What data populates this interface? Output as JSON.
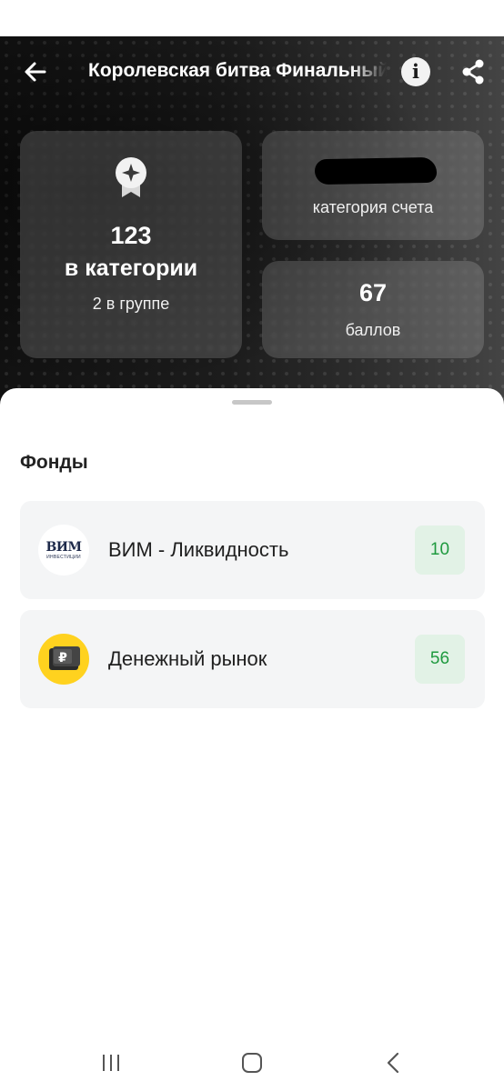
{
  "header": {
    "title": "Королевская битва Финальный",
    "back_icon": "arrow-left-icon",
    "info_label": "i",
    "share_icon": "share-icon"
  },
  "stats": {
    "rank": {
      "icon": "medal-star-icon",
      "value": "123",
      "label": "в категории",
      "sub": "2 в группе"
    },
    "account": {
      "value_redacted": true,
      "label": "категория счета"
    },
    "points": {
      "value": "67",
      "label": "баллов"
    }
  },
  "funds": {
    "title": "Фонды",
    "items": [
      {
        "logo_text": "ВИМ",
        "logo_sub": "ИНВЕСТИЦИИ",
        "name": "ВИМ - Ликвидность",
        "badge": "10"
      },
      {
        "logo_icon": "ruble-wallet-icon",
        "name": "Денежный рынок",
        "badge": "56"
      }
    ]
  },
  "colors": {
    "badge_bg": "#e2f2e6",
    "badge_text": "#1f9a3f",
    "row_bg": "#f4f5f6",
    "money_logo": "#ffd21f"
  },
  "system_nav": [
    "recents-icon",
    "home-icon",
    "back-icon"
  ]
}
